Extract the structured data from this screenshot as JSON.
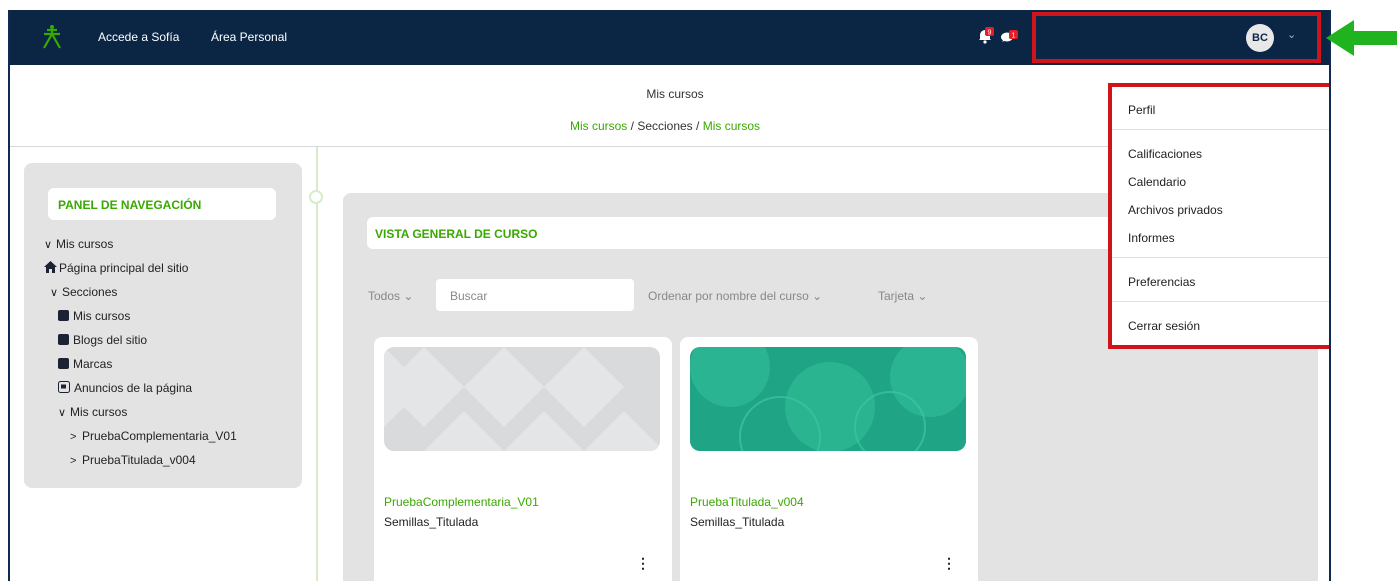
{
  "topbar": {
    "links": [
      "Accede a Sofía",
      "Área Personal"
    ],
    "avatar_initials": "BC",
    "notification_badge": "9",
    "message_badge": "1"
  },
  "header": {
    "page_title": "Mis cursos",
    "breadcrumb": [
      "Mis cursos",
      "Secciones",
      "Mis cursos"
    ]
  },
  "nav_panel": {
    "title": "PANEL DE NAVEGACIÓN",
    "items": [
      "Mis cursos",
      "Página principal del sitio",
      "Secciones",
      "Mis cursos",
      "Blogs del sitio",
      "Marcas",
      "Anuncios de la página",
      "Mis cursos",
      "PruebaComplementaria_V01",
      "PruebaTitulada_v004"
    ]
  },
  "overview": {
    "title": "VISTA GENERAL DE CURSO",
    "filter": "Todos",
    "search_placeholder": "Buscar",
    "sort": "Ordenar por nombre del curso",
    "view": "Tarjeta"
  },
  "courses": [
    {
      "name": "PruebaComplementaria_V01",
      "category": "Semillas_Titulada"
    },
    {
      "name": "PruebaTitulada_v004",
      "category": "Semillas_Titulada"
    }
  ],
  "user_menu": {
    "items": [
      "Perfil",
      "Calificaciones",
      "Calendario",
      "Archivos privados",
      "Informes",
      "Preferencias",
      "Cerrar sesión"
    ]
  },
  "colors": {
    "topbar": "#0b2545",
    "accent_green": "#39a900",
    "highlight_red": "#d0141b",
    "arrow_green": "#1fb31f"
  }
}
